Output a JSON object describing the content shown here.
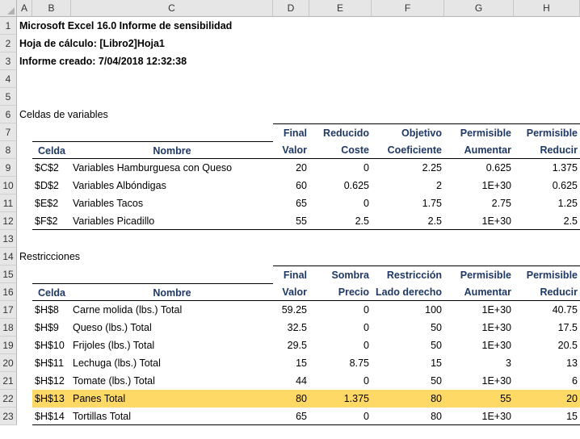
{
  "columns": [
    "A",
    "B",
    "C",
    "D",
    "E",
    "F",
    "G",
    "H"
  ],
  "rows": [
    "1",
    "2",
    "3",
    "4",
    "5",
    "6",
    "7",
    "8",
    "9",
    "10",
    "11",
    "12",
    "13",
    "14",
    "15",
    "16",
    "17",
    "18",
    "19",
    "20",
    "21",
    "22",
    "23"
  ],
  "header": {
    "title": "Microsoft Excel 16.0 Informe de sensibilidad",
    "sheet": "Hoja de cálculo: [Libro2]Hoja1",
    "created": "Informe creado: 7/04/2018 12:32:38"
  },
  "variables": {
    "section_title": "Celdas de variables",
    "head1": [
      "",
      "",
      "Final",
      "Reducido",
      "Objetivo",
      "Permisible",
      "Permisible"
    ],
    "head2": [
      "Celda",
      "Nombre",
      "Valor",
      "Coste",
      "Coeficiente",
      "Aumentar",
      "Reducir"
    ],
    "rows": [
      [
        "$C$2",
        "Variables Hamburguesa con Queso",
        "20",
        "0",
        "2.25",
        "0.625",
        "1.375"
      ],
      [
        "$D$2",
        "Variables Albóndigas",
        "60",
        "0.625",
        "2",
        "1E+30",
        "0.625"
      ],
      [
        "$E$2",
        "Variables Tacos",
        "65",
        "0",
        "1.75",
        "2.75",
        "1.25"
      ],
      [
        "$F$2",
        "Variables Picadillo",
        "55",
        "2.5",
        "2.5",
        "1E+30",
        "2.5"
      ]
    ]
  },
  "constraints": {
    "section_title": "Restricciones",
    "head1": [
      "",
      "",
      "Final",
      "Sombra",
      "Restricción",
      "Permisible",
      "Permisible"
    ],
    "head2": [
      "Celda",
      "Nombre",
      "Valor",
      "Precio",
      "Lado derecho",
      "Aumentar",
      "Reducir"
    ],
    "rows": [
      [
        "$H$8",
        "Carne molida (lbs.) Total",
        "59.25",
        "0",
        "100",
        "1E+30",
        "40.75"
      ],
      [
        "$H$9",
        "Queso (lbs.) Total",
        "32.5",
        "0",
        "50",
        "1E+30",
        "17.5"
      ],
      [
        "$H$10",
        "Frijoles (lbs.) Total",
        "29.5",
        "0",
        "50",
        "1E+30",
        "20.5"
      ],
      [
        "$H$11",
        "Lechuga (lbs.) Total",
        "15",
        "8.75",
        "15",
        "3",
        "13"
      ],
      [
        "$H$12",
        "Tomate (lbs.) Total",
        "44",
        "0",
        "50",
        "1E+30",
        "6"
      ],
      [
        "$H$13",
        "Panes Total",
        "80",
        "1.375",
        "80",
        "55",
        "20"
      ],
      [
        "$H$14",
        "Tortillas Total",
        "65",
        "0",
        "80",
        "1E+30",
        "15"
      ]
    ]
  },
  "colors": {
    "highlight": "#ffd966",
    "header_text": "#1f3864",
    "header_bg": "#e6e6e6"
  }
}
